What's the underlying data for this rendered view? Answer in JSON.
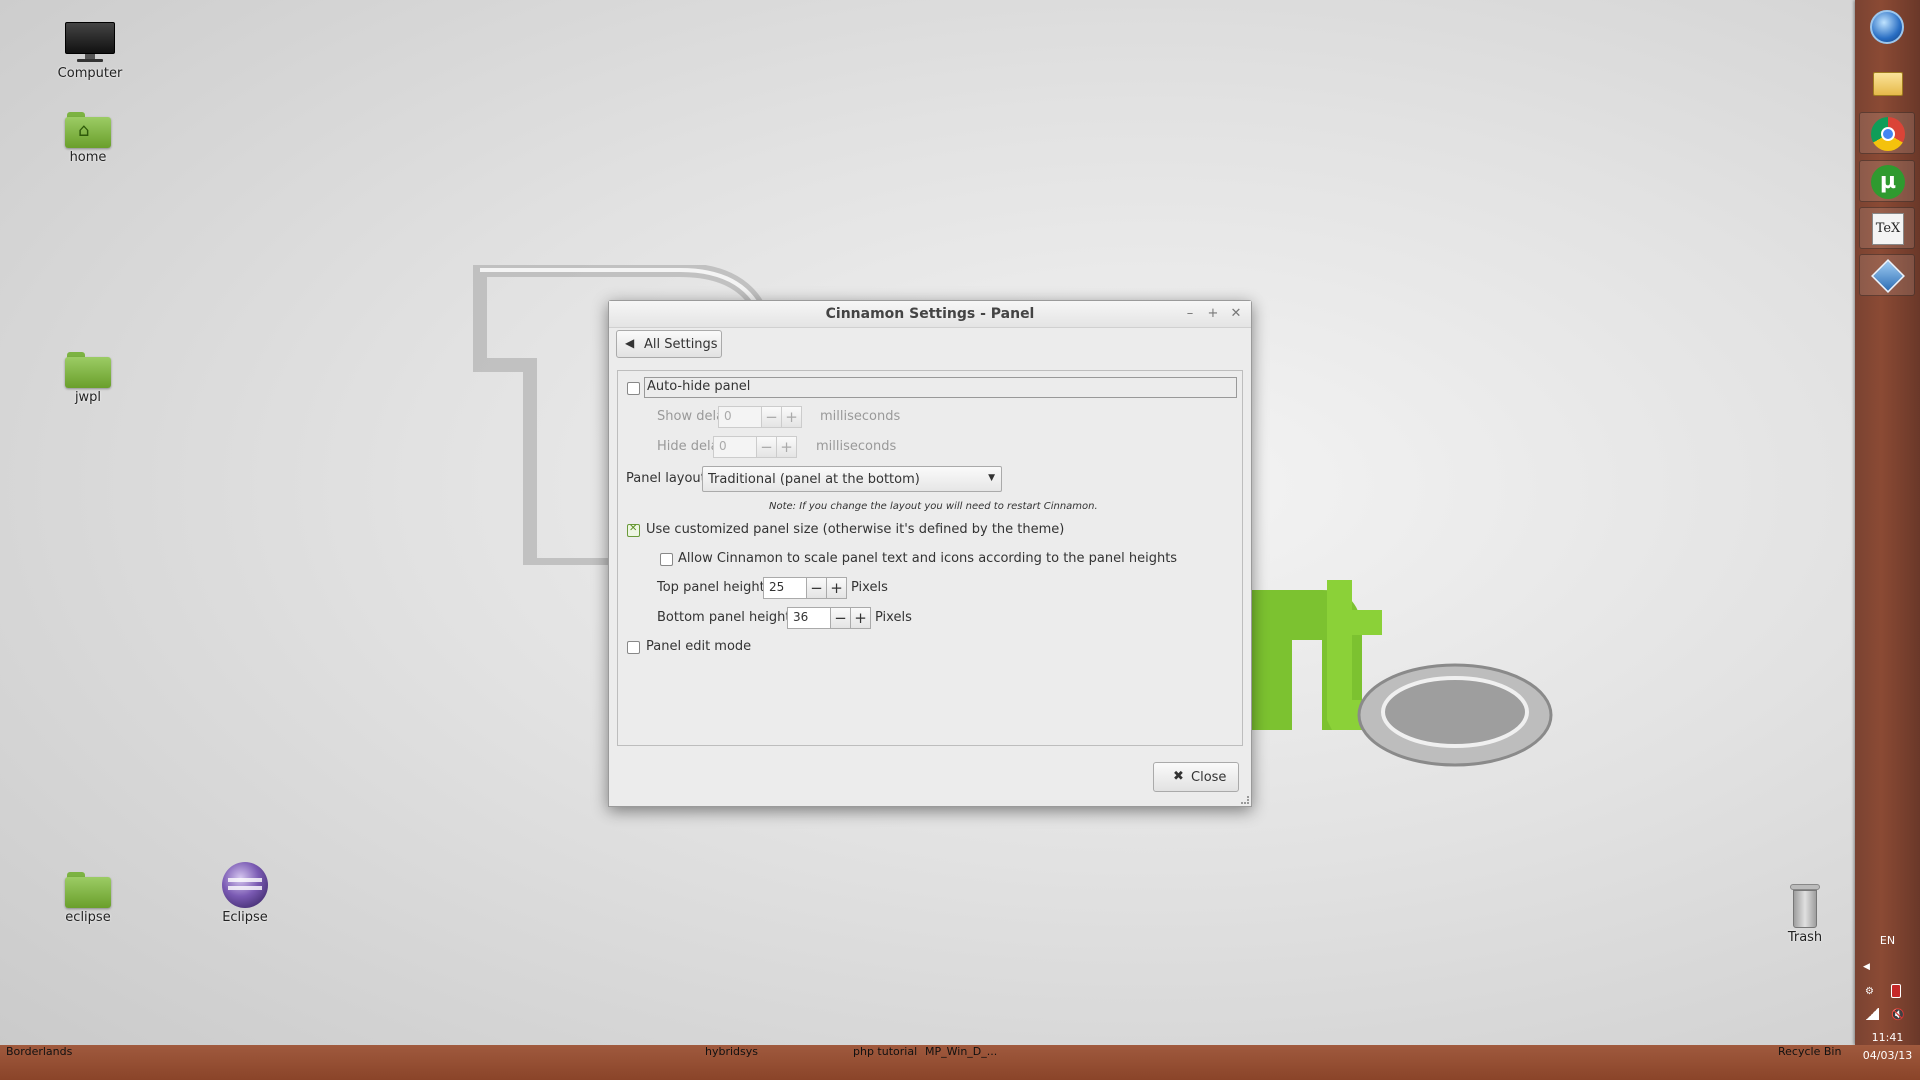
{
  "desktop": {
    "icons": [
      {
        "label": "Computer"
      },
      {
        "label": "home"
      },
      {
        "label": "jwpl"
      },
      {
        "label": "eclipse"
      },
      {
        "label": "Eclipse"
      },
      {
        "label": "Trash"
      }
    ]
  },
  "dialog": {
    "title": "Cinnamon Settings - Panel",
    "all_settings_label": "All Settings",
    "autohide": {
      "label": "Auto-hide panel",
      "checked": false
    },
    "show_delay": {
      "label": "Show delay",
      "value": "0",
      "unit": "milliseconds"
    },
    "hide_delay": {
      "label": "Hide delay",
      "value": "0",
      "unit": "milliseconds"
    },
    "panel_layout": {
      "label": "Panel layout",
      "selected": "Traditional (panel at the bottom)"
    },
    "layout_note": "Note: If you change the layout you will need to restart Cinnamon.",
    "custom_size": {
      "label": "Use customized panel size (otherwise it's defined by the theme)",
      "checked": true
    },
    "scale": {
      "label": "Allow Cinnamon to scale panel text and icons according to the panel heights",
      "checked": false
    },
    "top_height": {
      "label": "Top panel height",
      "value": "25",
      "unit": "Pixels"
    },
    "bottom_height": {
      "label": "Bottom panel height",
      "value": "36",
      "unit": "Pixels"
    },
    "edit_mode": {
      "label": "Panel edit mode",
      "checked": false
    },
    "close_label": "Close",
    "minus": "−",
    "plus": "+"
  },
  "dock": {
    "apps": [
      "start-orb-icon",
      "file-manager-icon",
      "chrome-icon",
      "utorrent-icon",
      "tex-icon",
      "virtualbox-icon"
    ],
    "language": "EN",
    "clock_time": "11:41",
    "clock_date": "04/03/13"
  },
  "taskbar": {
    "items": [
      "Borderlands",
      "hybridsys",
      "php tutorial",
      "MP_Win_D_...",
      "Recycle Bin"
    ]
  },
  "colors": {
    "dock": "#8b4a34",
    "taskbar": "#a05a3e",
    "mint_green": "#7cc230"
  }
}
